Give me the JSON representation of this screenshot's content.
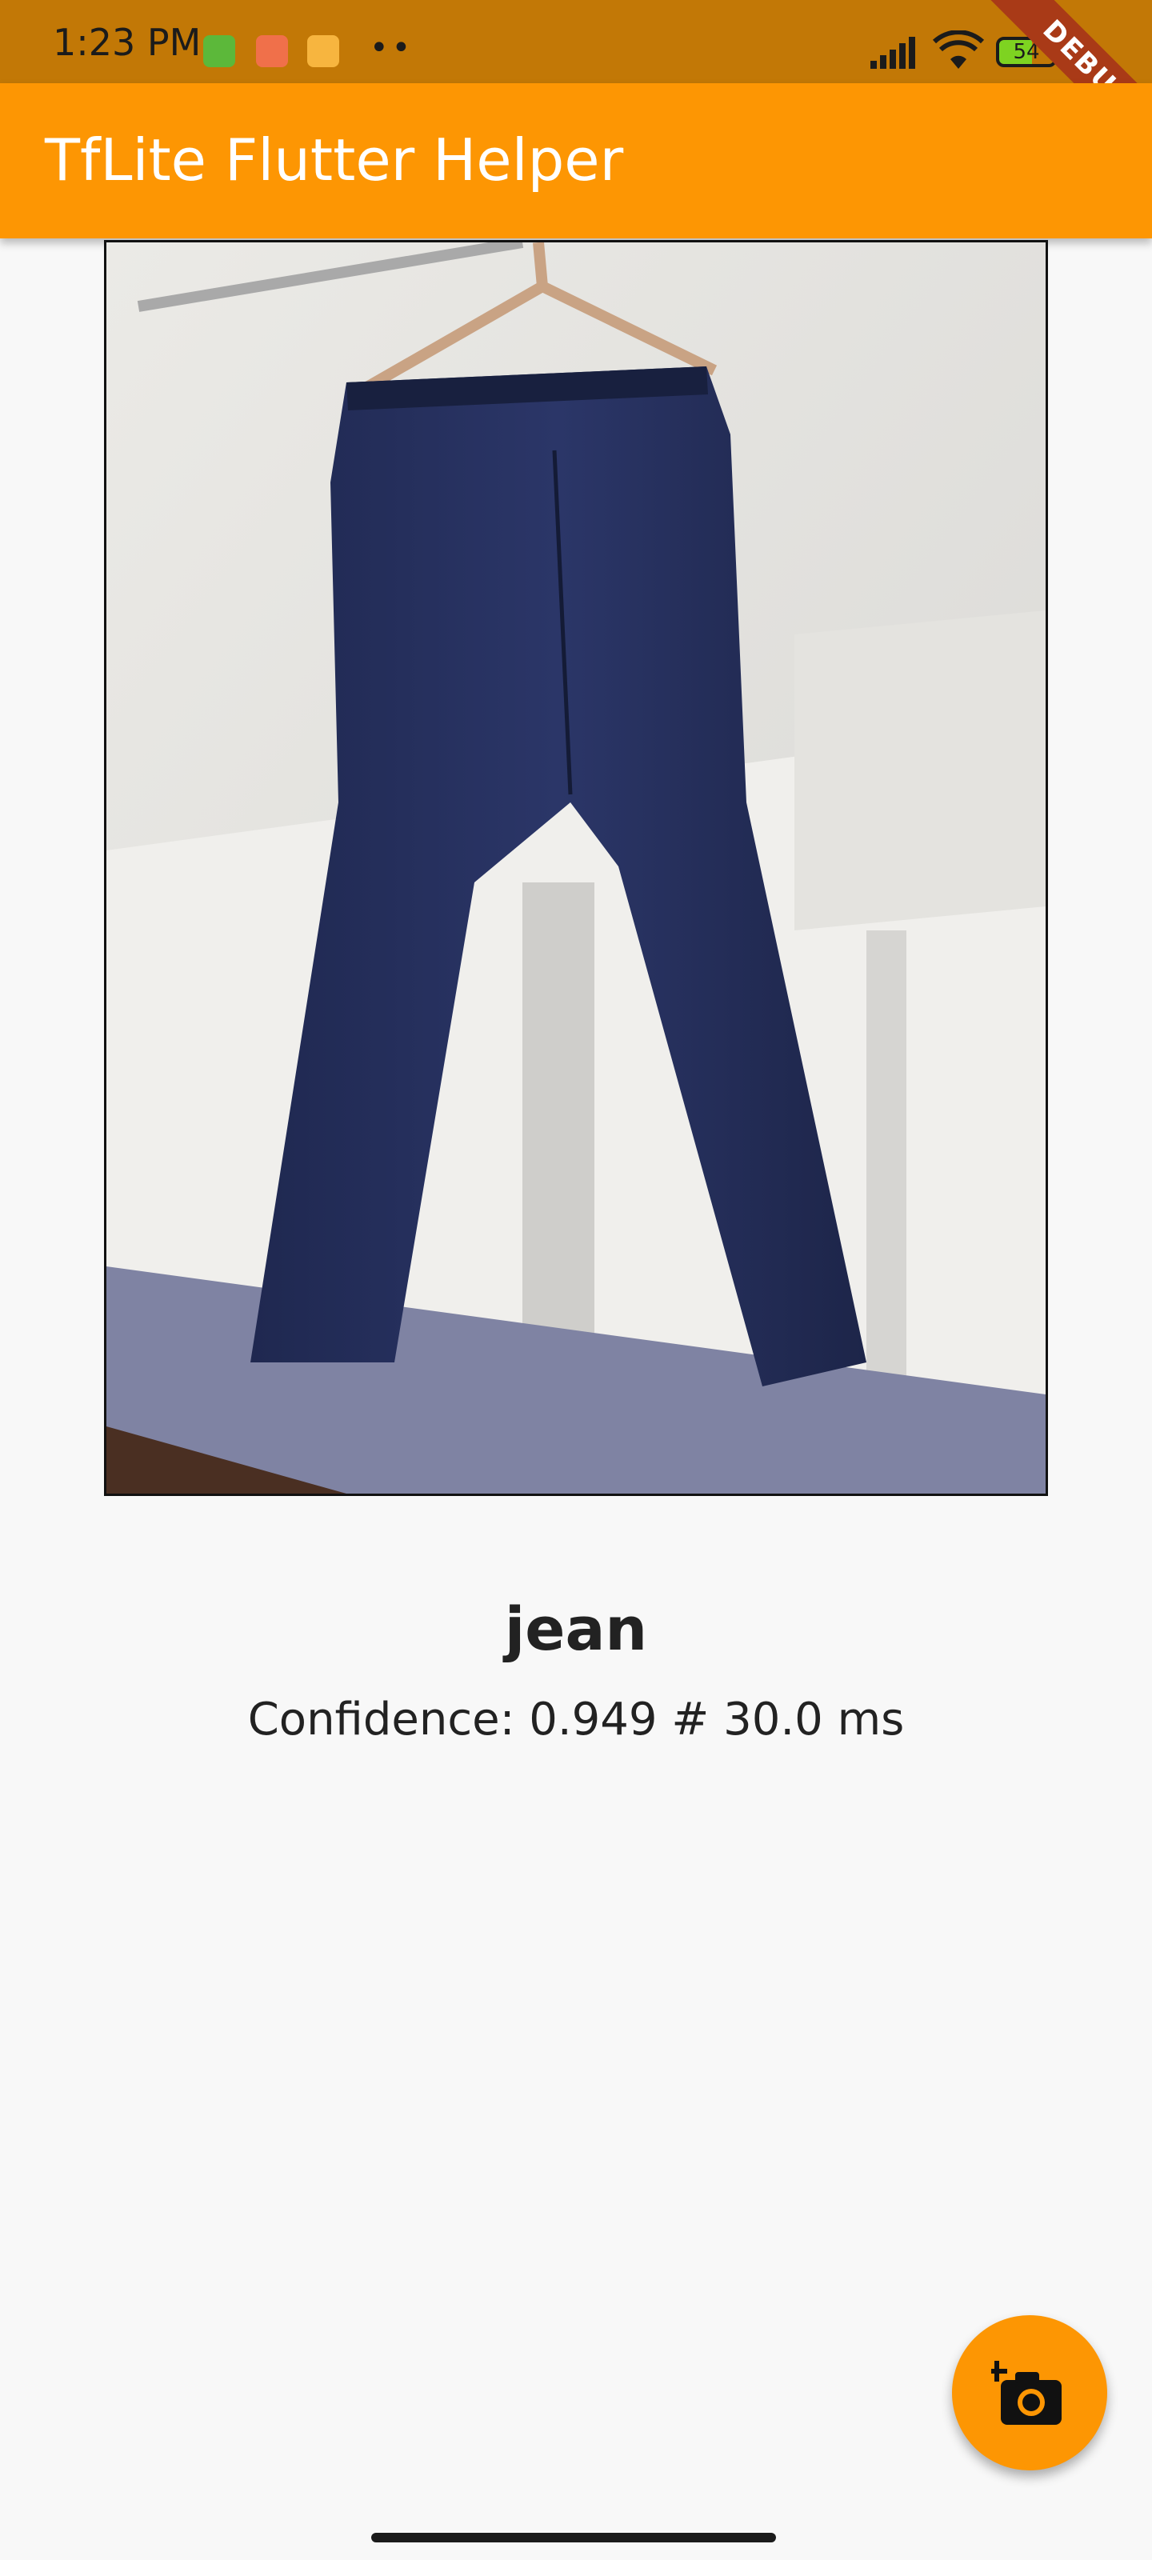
{
  "status_bar": {
    "time": "1:23 PM",
    "battery_level": "54",
    "notification_icons": [
      "android-icon",
      "shopping-icon",
      "gallery-icon"
    ],
    "more_notifications": "••",
    "debug_banner": "DEBUG"
  },
  "app_bar": {
    "title": "TfLite Flutter Helper",
    "color": "#fd9603"
  },
  "image": {
    "subject": "jeans on hanger"
  },
  "result": {
    "label": "jean",
    "confidence_text": "Confidence: 0.949 # 30.0 ms"
  },
  "fab": {
    "icon": "add-a-photo-icon",
    "color": "#fd9603"
  }
}
